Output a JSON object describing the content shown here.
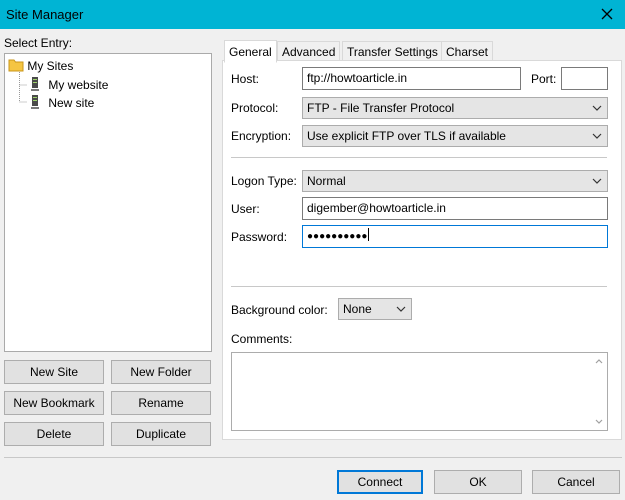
{
  "window": {
    "title": "Site Manager"
  },
  "left": {
    "select_entry_label": "Select Entry:",
    "tree": [
      {
        "label": "My Sites",
        "icon": "folder-icon"
      },
      {
        "label": "My website",
        "icon": "server-icon"
      },
      {
        "label": "New site",
        "icon": "server-icon"
      }
    ],
    "buttons": {
      "new_site": "New Site",
      "new_folder": "New Folder",
      "new_bookmark": "New Bookmark",
      "rename": "Rename",
      "delete": "Delete",
      "duplicate": "Duplicate"
    }
  },
  "tabs": [
    "General",
    "Advanced",
    "Transfer Settings",
    "Charset"
  ],
  "general": {
    "host_label": "Host:",
    "host_value": "ftp://howtoarticle.in",
    "port_label": "Port:",
    "port_value": "",
    "protocol_label": "Protocol:",
    "protocol_value": "FTP - File Transfer Protocol",
    "encryption_label": "Encryption:",
    "encryption_value": "Use explicit FTP over TLS if available",
    "logon_type_label": "Logon Type:",
    "logon_type_value": "Normal",
    "user_label": "User:",
    "user_value": "digember@howtoarticle.in",
    "password_label": "Password:",
    "password_value": "●●●●●●●●●●",
    "background_color_label": "Background color:",
    "background_color_value": "None",
    "comments_label": "Comments:"
  },
  "footer": {
    "connect": "Connect",
    "ok": "OK",
    "cancel": "Cancel"
  },
  "colors": {
    "titlebar": "#00b4d4",
    "accent": "#0078d7"
  }
}
